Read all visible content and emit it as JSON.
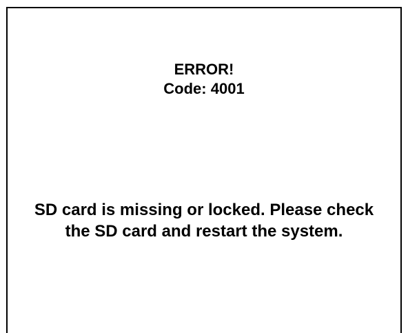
{
  "error": {
    "title": "ERROR!",
    "code_line": "Code: 4001",
    "message": "SD card is missing or locked. Please check the SD card and restart the system."
  }
}
